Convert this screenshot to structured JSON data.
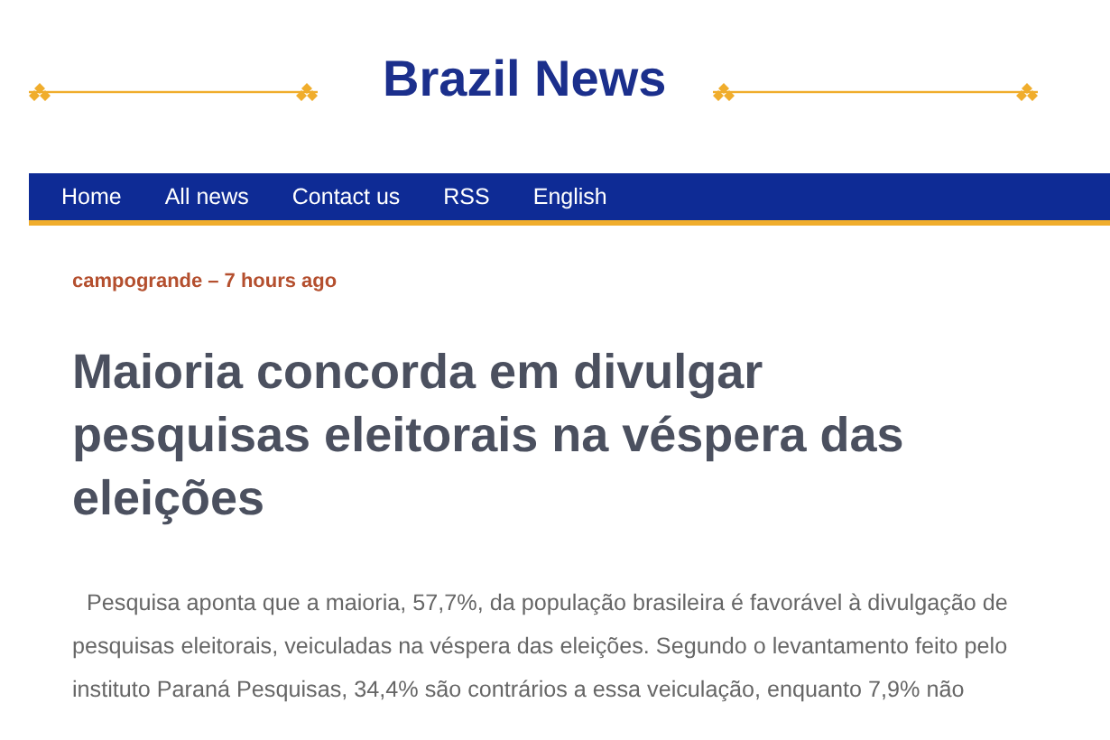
{
  "site_title": "Brazil News",
  "nav": [
    {
      "label": "Home"
    },
    {
      "label": "All news"
    },
    {
      "label": "Contact us"
    },
    {
      "label": "RSS"
    },
    {
      "label": "English"
    }
  ],
  "article": {
    "source": "campogrande",
    "separator": "–",
    "time": "7 hours ago",
    "headline": "Maioria concorda em divulgar pesquisas eleitorais na véspera das eleições",
    "body": "Pesquisa aponta que a maioria, 57,7%, da população brasileira é favorável à divulgação de pesquisas eleitorais, veiculadas na véspera das eleições. Segundo o levantamento feito pelo instituto Paraná Pesquisas, 34,4% são contrários a essa veiculação, enquanto 7,9% não"
  }
}
